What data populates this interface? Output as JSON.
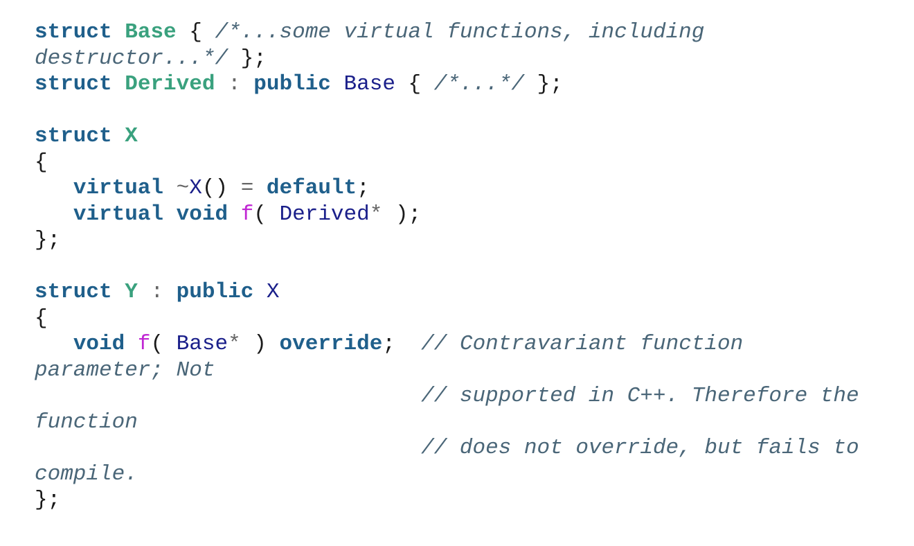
{
  "lines": [
    [
      {
        "c": "kw",
        "t": "struct"
      },
      {
        "c": "pn",
        "t": " "
      },
      {
        "c": "ty",
        "t": "Base"
      },
      {
        "c": "pn",
        "t": " { "
      },
      {
        "c": "cm",
        "t": "/*...some virtual functions, including"
      }
    ],
    [
      {
        "c": "cm",
        "t": "destructor...*/"
      },
      {
        "c": "pn",
        "t": " };"
      }
    ],
    [
      {
        "c": "kw",
        "t": "struct"
      },
      {
        "c": "pn",
        "t": " "
      },
      {
        "c": "ty",
        "t": "Derived"
      },
      {
        "c": "op",
        "t": " : "
      },
      {
        "c": "kw",
        "t": "public"
      },
      {
        "c": "pn",
        "t": " "
      },
      {
        "c": "id",
        "t": "Base"
      },
      {
        "c": "pn",
        "t": " { "
      },
      {
        "c": "cm",
        "t": "/*...*/"
      },
      {
        "c": "pn",
        "t": " };"
      }
    ],
    [],
    [
      {
        "c": "kw",
        "t": "struct"
      },
      {
        "c": "pn",
        "t": " "
      },
      {
        "c": "ty",
        "t": "X"
      }
    ],
    [
      {
        "c": "pn",
        "t": "{"
      }
    ],
    [
      {
        "c": "pn",
        "t": "   "
      },
      {
        "c": "kw",
        "t": "virtual"
      },
      {
        "c": "pn",
        "t": " "
      },
      {
        "c": "op",
        "t": "~"
      },
      {
        "c": "id",
        "t": "X"
      },
      {
        "c": "pn",
        "t": "() "
      },
      {
        "c": "op",
        "t": "="
      },
      {
        "c": "pn",
        "t": " "
      },
      {
        "c": "kw",
        "t": "default"
      },
      {
        "c": "pn",
        "t": ";"
      }
    ],
    [
      {
        "c": "pn",
        "t": "   "
      },
      {
        "c": "kw",
        "t": "virtual"
      },
      {
        "c": "pn",
        "t": " "
      },
      {
        "c": "kw",
        "t": "void"
      },
      {
        "c": "pn",
        "t": " "
      },
      {
        "c": "fn",
        "t": "f"
      },
      {
        "c": "pn",
        "t": "( "
      },
      {
        "c": "id",
        "t": "Derived"
      },
      {
        "c": "op",
        "t": "*"
      },
      {
        "c": "pn",
        "t": " );"
      }
    ],
    [
      {
        "c": "pn",
        "t": "};"
      }
    ],
    [],
    [
      {
        "c": "kw",
        "t": "struct"
      },
      {
        "c": "pn",
        "t": " "
      },
      {
        "c": "ty",
        "t": "Y"
      },
      {
        "c": "op",
        "t": " : "
      },
      {
        "c": "kw",
        "t": "public"
      },
      {
        "c": "pn",
        "t": " "
      },
      {
        "c": "id",
        "t": "X"
      }
    ],
    [
      {
        "c": "pn",
        "t": "{"
      }
    ],
    [
      {
        "c": "pn",
        "t": "   "
      },
      {
        "c": "kw",
        "t": "void"
      },
      {
        "c": "pn",
        "t": " "
      },
      {
        "c": "fn",
        "t": "f"
      },
      {
        "c": "pn",
        "t": "( "
      },
      {
        "c": "id",
        "t": "Base"
      },
      {
        "c": "op",
        "t": "*"
      },
      {
        "c": "pn",
        "t": " ) "
      },
      {
        "c": "kw",
        "t": "override"
      },
      {
        "c": "pn",
        "t": ";  "
      },
      {
        "c": "cm",
        "t": "// Contravariant function"
      }
    ],
    [
      {
        "c": "cm",
        "t": "parameter; Not"
      }
    ],
    [
      {
        "c": "pn",
        "t": "                              "
      },
      {
        "c": "cm",
        "t": "// supported in C++. Therefore the"
      }
    ],
    [
      {
        "c": "cm",
        "t": "function"
      }
    ],
    [
      {
        "c": "pn",
        "t": "                              "
      },
      {
        "c": "cm",
        "t": "// does not override, but fails to"
      }
    ],
    [
      {
        "c": "cm",
        "t": "compile."
      }
    ],
    [
      {
        "c": "pn",
        "t": "};"
      }
    ]
  ]
}
